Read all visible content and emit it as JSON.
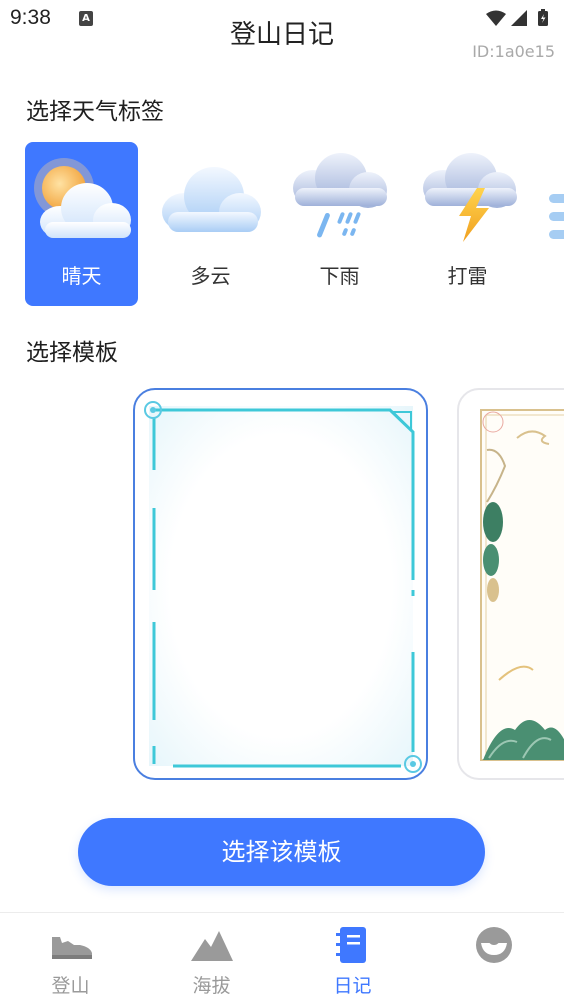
{
  "status_bar": {
    "time": "9:38",
    "notification_icon": "a-icon",
    "icons": [
      "wifi-icon",
      "signal-icon",
      "battery-icon"
    ]
  },
  "header": {
    "title": "登山日记",
    "id_label": "ID:1a0e15"
  },
  "weather": {
    "title": "选择天气标签",
    "items": [
      {
        "label": "晴天",
        "icon": "sunny-icon",
        "selected": true
      },
      {
        "label": "多云",
        "icon": "cloudy-icon",
        "selected": false
      },
      {
        "label": "下雨",
        "icon": "rain-icon",
        "selected": false
      },
      {
        "label": "打雷",
        "icon": "thunder-icon",
        "selected": false
      },
      {
        "label": "",
        "icon": "partial-weather-icon",
        "selected": false
      }
    ]
  },
  "templates": {
    "title": "选择模板",
    "items": [
      {
        "name": "tech-frame-template",
        "selected": true
      },
      {
        "name": "chinese-landscape-template",
        "selected": false
      }
    ]
  },
  "actions": {
    "select_template_label": "选择该模板"
  },
  "bottom_nav": {
    "items": [
      {
        "label": "登山",
        "icon": "hiking-shoe-icon",
        "active": false
      },
      {
        "label": "海拔",
        "icon": "mountain-icon",
        "active": false
      },
      {
        "label": "日记",
        "icon": "notebook-icon",
        "active": true
      },
      {
        "label": "",
        "icon": "profile-icon",
        "active": false
      }
    ]
  },
  "colors": {
    "accent": "#3f78ff",
    "inactive_nav": "#9a9a9a",
    "template_border": "#4a7fe0"
  }
}
